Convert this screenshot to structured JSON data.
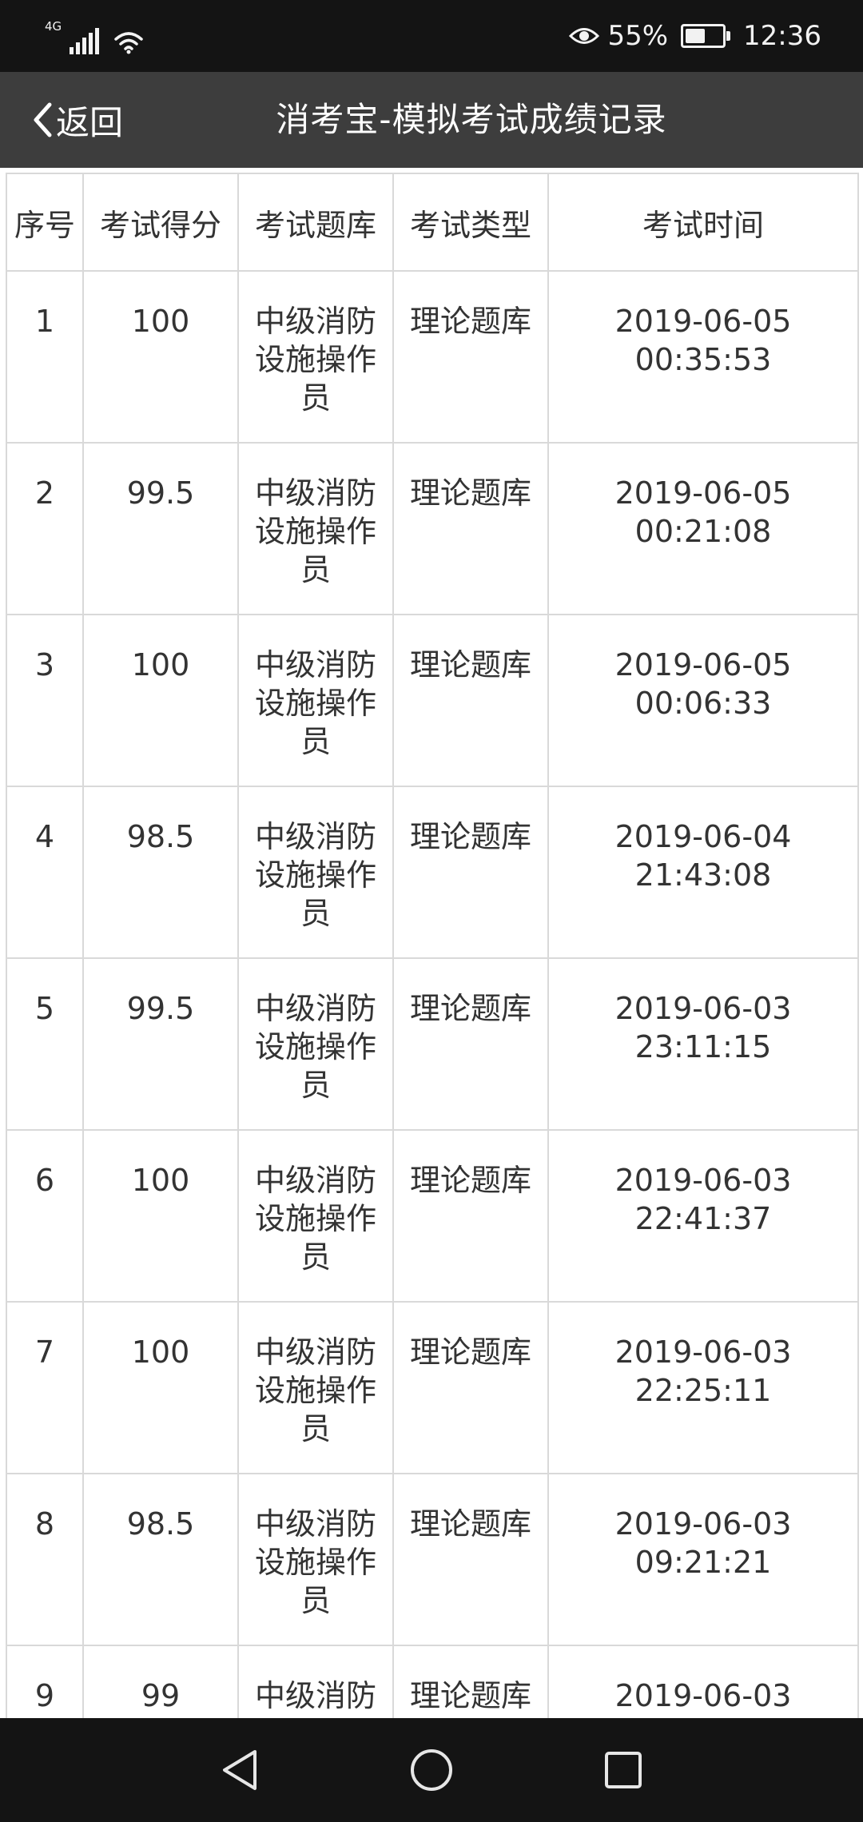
{
  "status_bar": {
    "network": "4G",
    "battery_percent": "55%",
    "battery_level": 0.55,
    "time": "12:36",
    "icons": [
      "signal-icon",
      "wifi-icon",
      "eye-icon",
      "battery-icon"
    ]
  },
  "title_bar": {
    "back_label": "返回",
    "title": "消考宝-模拟考试成绩记录"
  },
  "table": {
    "headers": [
      "序号",
      "考试得分",
      "考试题库",
      "考试类型",
      "考试时间"
    ],
    "rows": [
      {
        "no": "1",
        "score": "100",
        "bank": "中级消防设施操作员",
        "type": "理论题库",
        "date": "2019-06-05",
        "time": "00:35:53"
      },
      {
        "no": "2",
        "score": "99.5",
        "bank": "中级消防设施操作员",
        "type": "理论题库",
        "date": "2019-06-05",
        "time": "00:21:08"
      },
      {
        "no": "3",
        "score": "100",
        "bank": "中级消防设施操作员",
        "type": "理论题库",
        "date": "2019-06-05",
        "time": "00:06:33"
      },
      {
        "no": "4",
        "score": "98.5",
        "bank": "中级消防设施操作员",
        "type": "理论题库",
        "date": "2019-06-04",
        "time": "21:43:08"
      },
      {
        "no": "5",
        "score": "99.5",
        "bank": "中级消防设施操作员",
        "type": "理论题库",
        "date": "2019-06-03",
        "time": "23:11:15"
      },
      {
        "no": "6",
        "score": "100",
        "bank": "中级消防设施操作员",
        "type": "理论题库",
        "date": "2019-06-03",
        "time": "22:41:37"
      },
      {
        "no": "7",
        "score": "100",
        "bank": "中级消防设施操作员",
        "type": "理论题库",
        "date": "2019-06-03",
        "time": "22:25:11"
      },
      {
        "no": "8",
        "score": "98.5",
        "bank": "中级消防设施操作员",
        "type": "理论题库",
        "date": "2019-06-03",
        "time": "09:21:21"
      },
      {
        "no": "9",
        "score": "99",
        "bank": "中级消防设施操作员",
        "type": "理论题库",
        "date": "2019-06-03",
        "time": ""
      }
    ]
  },
  "nav_bar": {
    "icons": [
      "back-triangle-icon",
      "home-circle-icon",
      "recents-square-icon"
    ]
  }
}
